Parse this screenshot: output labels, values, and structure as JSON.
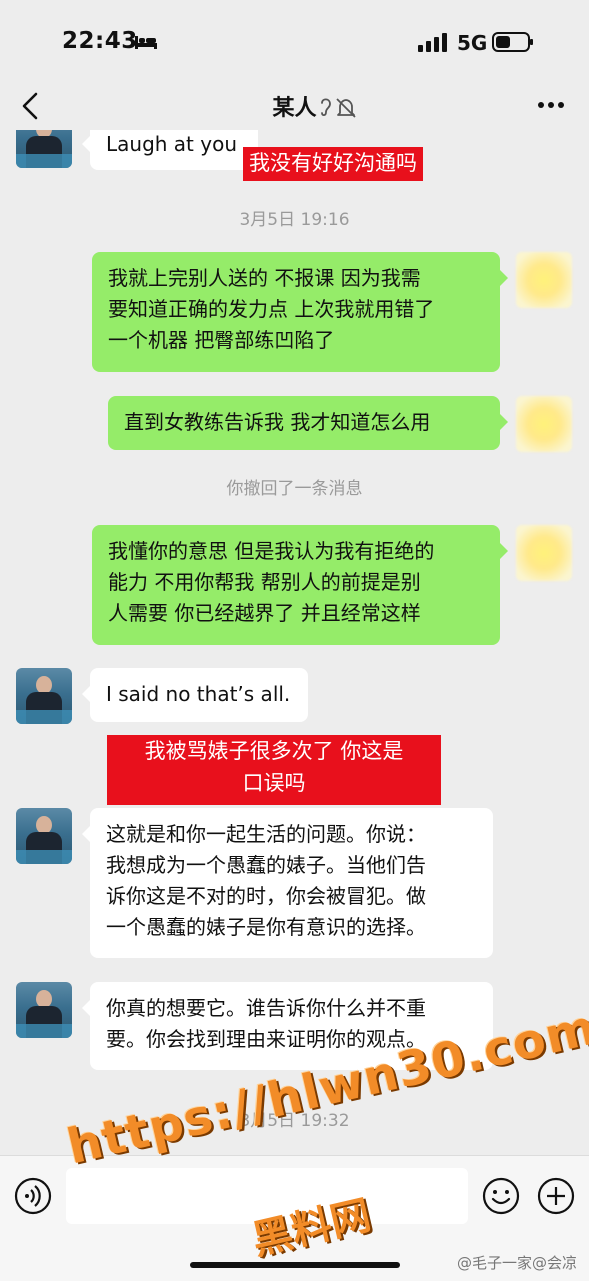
{
  "status_bar": {
    "time": "22:43",
    "network": "5G"
  },
  "nav": {
    "title": "某人"
  },
  "messages": {
    "top_in": "Laugh at you",
    "red_1": "我没有好好沟通吗",
    "time_1": "3月5日 19:16",
    "out_1": "我就上完别人送的 不报课 因为我需\n要知道正确的发力点 上次我就用错了\n一个机器 把臀部练凹陷了",
    "out_2": "直到女教练告诉我 我才知道怎么用",
    "recall": "你撤回了一条消息",
    "out_3": "我懂你的意思 但是我认为我有拒绝的\n能力 不用你帮我 帮别人的前提是别\n人需要 你已经越界了 并且经常这样",
    "in_1": "I said no that’s all.",
    "red_2": "我被骂婊子很多次了 你这是\n口误吗",
    "in_2": "这就是和你一起生活的问题。你说：\n我想成为一个愚蠢的婊子。当他们告\n诉你这是不对的时，你会被冒犯。做\n一个愚蠢的婊子是你有意识的选择。",
    "in_3": "你真的想要它。谁告诉你什么并不重\n要。你会找到理由来证明你的观点。",
    "time_2": "3月5日 19:32"
  },
  "watermark": {
    "url": "https://hlwn30.com",
    "site": "黑料网",
    "weibo": "@毛子一家@会凉"
  },
  "colors": {
    "background": "#ededed",
    "out_bubble": "#95ec69",
    "in_bubble": "#ffffff",
    "red_label": "#e8101c",
    "watermark": "#f28c28"
  },
  "icons": [
    "back-chevron-icon",
    "mute-bell-icon",
    "more-icon",
    "voice-icon",
    "emoji-icon",
    "plus-icon"
  ]
}
